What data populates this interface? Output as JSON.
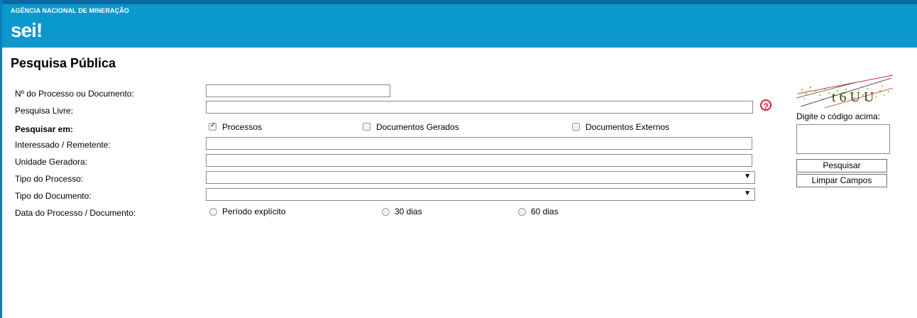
{
  "header": {
    "agency": "AGÊNCIA NACIONAL DE MINERAÇÃO",
    "logo_text": "sei",
    "logo_mark": "!"
  },
  "page_title": "Pesquisa Pública",
  "form": {
    "processo_label": "Nº do Processo ou Documento:",
    "processo_value": "",
    "pesquisa_livre_label": "Pesquisa Livre:",
    "pesquisa_livre_value": "",
    "help_icon": "?",
    "pesquisar_em_label": "Pesquisar em:",
    "checkboxes": [
      {
        "label": "Processos",
        "checked": true
      },
      {
        "label": "Documentos Gerados",
        "checked": false
      },
      {
        "label": "Documentos Externos",
        "checked": false
      }
    ],
    "interessado_label": "Interessado / Remetente:",
    "interessado_value": "",
    "unidade_label": "Unidade Geradora:",
    "unidade_value": "",
    "tipo_processo_label": "Tipo do Processo:",
    "tipo_processo_value": "",
    "tipo_documento_label": "Tipo do Documento:",
    "tipo_documento_value": "",
    "data_label": "Data do Processo / Documento:",
    "radios": [
      {
        "label": "Período explícito",
        "selected": false
      },
      {
        "label": "30 dias",
        "selected": false
      },
      {
        "label": "60 dias",
        "selected": false
      }
    ]
  },
  "captcha": {
    "code": "t6UU",
    "prompt": "Digite o código acima:",
    "input_value": ""
  },
  "buttons": {
    "search": "Pesquisar",
    "clear": "Limpar Campos"
  },
  "colors": {
    "header_bg": "#0b98cd",
    "header_strip": "#0b6aa2",
    "help_red": "#d0262d"
  }
}
